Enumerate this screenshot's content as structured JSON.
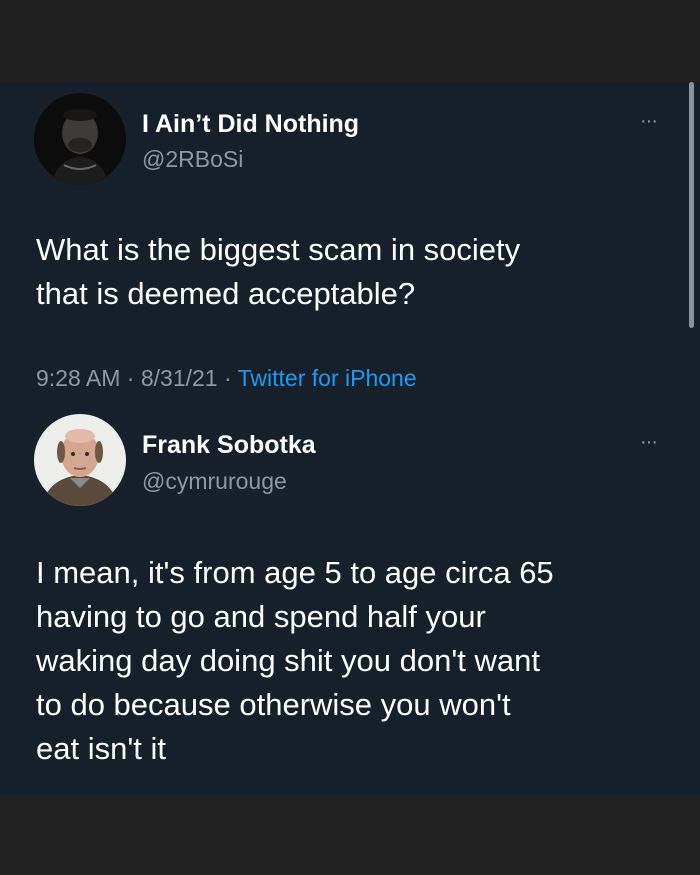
{
  "tweet": {
    "author_name": "I Ain’t Did Nothing",
    "author_handle": "@2RBoSi",
    "text_line1": "What is the biggest scam in society",
    "text_line2": "that is deemed acceptable?",
    "time": "9:28 AM",
    "date": "8/31/21",
    "separator": "·",
    "source": "Twitter for iPhone",
    "more_label": "···"
  },
  "reply": {
    "author_name": "Frank Sobotka",
    "author_handle": "@cymrurouge",
    "lines": [
      "I mean, it's from age 5 to age circa 65",
      "having to go and spend half your",
      "waking day doing shit you don't want",
      "to do because otherwise you won't",
      "eat isn't it"
    ],
    "more_label": "···"
  },
  "colors": {
    "card_background": "#15202b",
    "outer_background": "#212121",
    "primary_text": "#ffffff",
    "secondary_text": "#8b98a5",
    "link": "#1d9bf0"
  },
  "icons": {
    "tweet_more": "more-horizontal-icon",
    "reply_more": "more-horizontal-icon"
  }
}
